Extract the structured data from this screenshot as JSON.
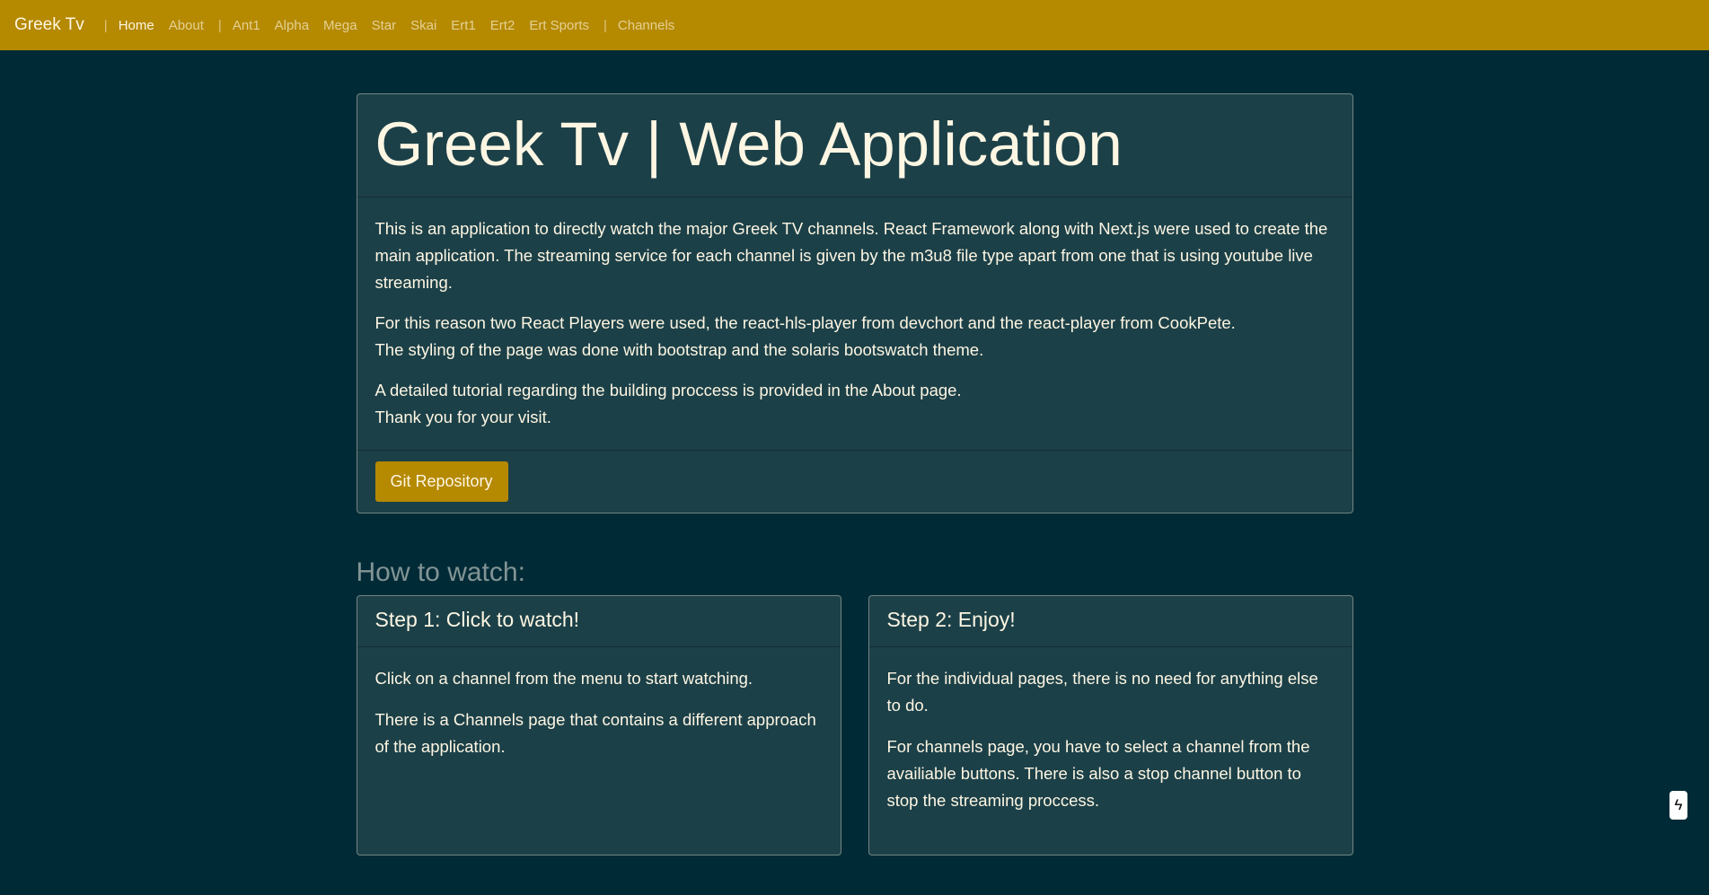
{
  "navbar": {
    "brand": "Greek Tv",
    "separator": "|",
    "links": {
      "home": "Home",
      "about": "About",
      "ant1": "Ant1",
      "alpha": "Alpha",
      "mega": "Mega",
      "star": "Star",
      "skai": "Skai",
      "ert1": "Ert1",
      "ert2": "Ert2",
      "ert_sports": "Ert Sports",
      "channels": "Channels"
    },
    "active": "Home"
  },
  "hero": {
    "title": "Greek Tv | Web Application",
    "paragraph_1": "This is an application to directly watch the major Greek TV channels. React Framework along with Next.js were used to create the main application. The streaming service for each channel is given by the m3u8 file type apart from one that is using youtube live streaming.",
    "paragraph_2_line_1": "For this reason two React Players were used, the react-hls-player from devchort and the react-player from CookPete.",
    "paragraph_2_line_2": "The styling of the page was done with bootstrap and the solaris bootswatch theme.",
    "paragraph_3_line_1": "A detailed tutorial regarding the building proccess is provided in the About page.",
    "paragraph_3_line_2": "Thank you for your visit.",
    "button_label": "Git Repository"
  },
  "how_to_watch": {
    "heading": "How to watch:",
    "step1": {
      "title": "Step 1: Click to watch!",
      "p1": "Click on a channel from the menu to start watching.",
      "p2": "There is a Channels page that contains a different approach of the application."
    },
    "step2": {
      "title": "Step 2: Enjoy!",
      "p1": "For the individual pages, there is no need for anything else to do.",
      "p2": "For channels page, you have to select a channel from the availiable buttons. There is also a stop channel button to stop the streaming proccess."
    }
  },
  "side_icon": {
    "name": "lightning-icon",
    "glyph": "ϟ"
  },
  "colors": {
    "navbar_bg": "#b58900",
    "page_bg": "#002b36",
    "card_bg": "#1c4048",
    "text": "#fdf6e3",
    "muted_heading": "#839496"
  }
}
